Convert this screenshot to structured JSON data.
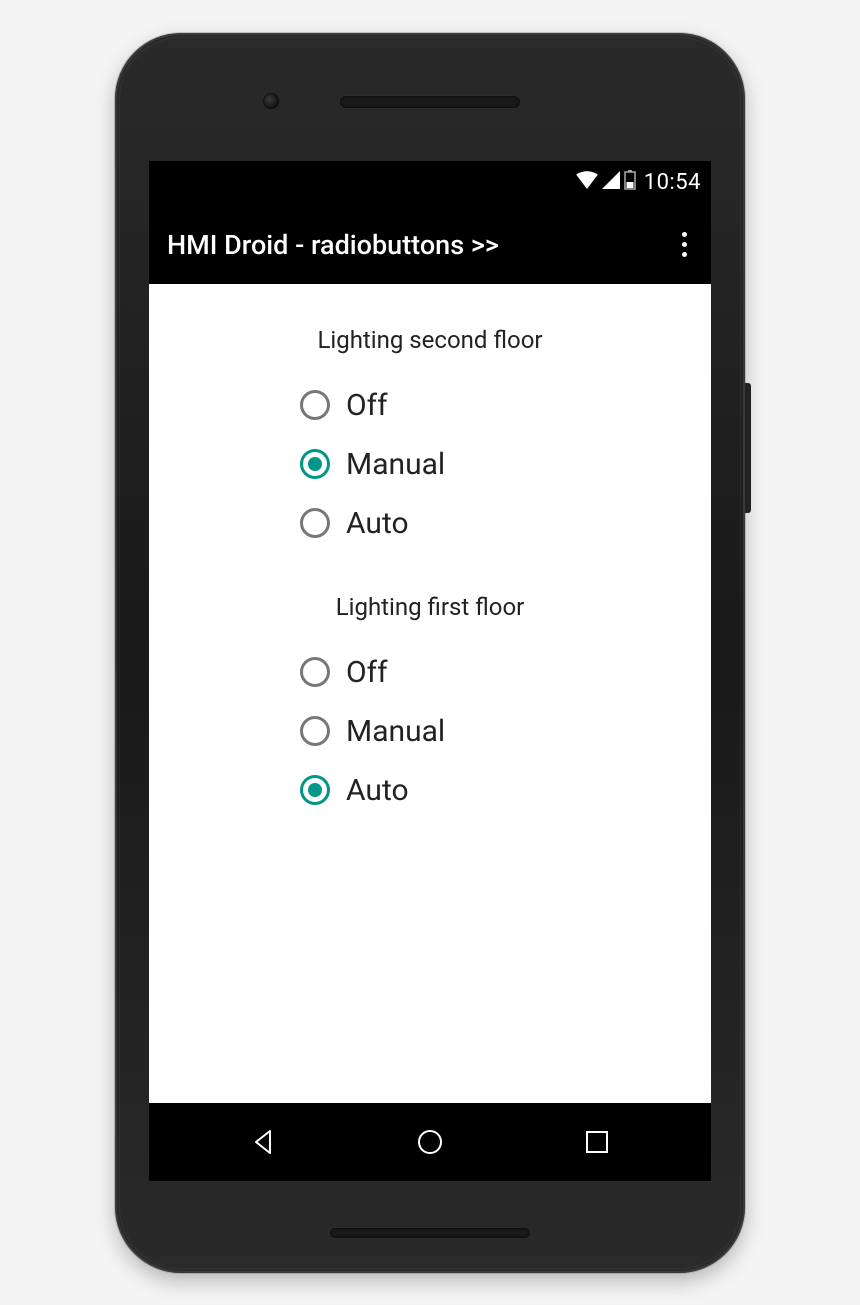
{
  "status": {
    "time": "10:54"
  },
  "appbar": {
    "title": "HMI Droid - radiobuttons >>"
  },
  "colors": {
    "accent": "#009688",
    "bar_bg": "#000000",
    "bar_fg": "#ffffff"
  },
  "groups": [
    {
      "title": "Lighting second floor",
      "options": [
        {
          "label": "Off",
          "checked": false
        },
        {
          "label": "Manual",
          "checked": true
        },
        {
          "label": "Auto",
          "checked": false
        }
      ]
    },
    {
      "title": "Lighting first floor",
      "options": [
        {
          "label": "Off",
          "checked": false
        },
        {
          "label": "Manual",
          "checked": false
        },
        {
          "label": "Auto",
          "checked": true
        }
      ]
    }
  ]
}
